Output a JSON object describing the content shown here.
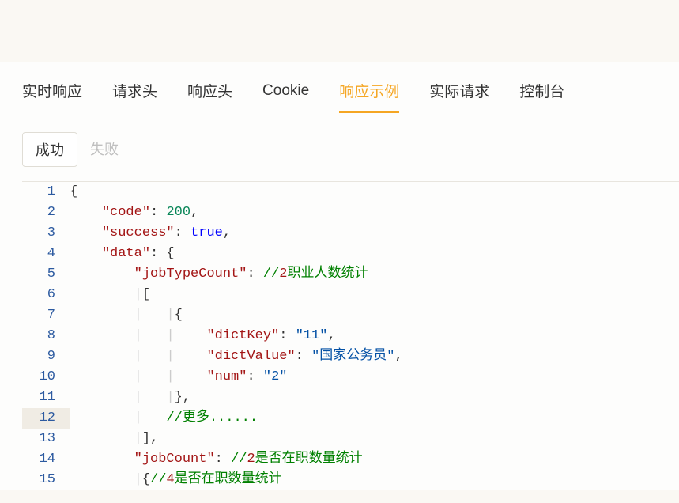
{
  "tabs": {
    "items": [
      {
        "label": "实时响应",
        "active": false
      },
      {
        "label": "请求头",
        "active": false
      },
      {
        "label": "响应头",
        "active": false
      },
      {
        "label": "Cookie",
        "active": false
      },
      {
        "label": "响应示例",
        "active": true
      },
      {
        "label": "实际请求",
        "active": false
      },
      {
        "label": "控制台",
        "active": false
      }
    ]
  },
  "subTabs": {
    "items": [
      {
        "label": "成功",
        "active": true
      },
      {
        "label": "失败",
        "active": false
      }
    ]
  },
  "code": {
    "lines": [
      {
        "n": "1",
        "tokens": [
          {
            "t": "punct",
            "v": "{"
          }
        ]
      },
      {
        "n": "2",
        "tokens": [
          {
            "t": "plain",
            "v": "    "
          },
          {
            "t": "key",
            "v": "\"code\""
          },
          {
            "t": "punct",
            "v": ": "
          },
          {
            "t": "num",
            "v": "200"
          },
          {
            "t": "punct",
            "v": ","
          }
        ]
      },
      {
        "n": "3",
        "tokens": [
          {
            "t": "plain",
            "v": "    "
          },
          {
            "t": "key",
            "v": "\"success\""
          },
          {
            "t": "punct",
            "v": ": "
          },
          {
            "t": "bool",
            "v": "true"
          },
          {
            "t": "punct",
            "v": ","
          }
        ]
      },
      {
        "n": "4",
        "tokens": [
          {
            "t": "plain",
            "v": "    "
          },
          {
            "t": "key",
            "v": "\"data\""
          },
          {
            "t": "punct",
            "v": ": {"
          }
        ]
      },
      {
        "n": "5",
        "tokens": [
          {
            "t": "plain",
            "v": "        "
          },
          {
            "t": "key",
            "v": "\"jobTypeCount\""
          },
          {
            "t": "punct",
            "v": ": "
          },
          {
            "t": "comment",
            "v": "//"
          },
          {
            "t": "commenthl",
            "v": "2"
          },
          {
            "t": "comment",
            "v": "职业人数统计"
          }
        ]
      },
      {
        "n": "6",
        "tokens": [
          {
            "t": "plain",
            "v": "        "
          },
          {
            "t": "guide",
            "v": "|"
          },
          {
            "t": "punct",
            "v": "["
          }
        ]
      },
      {
        "n": "7",
        "tokens": [
          {
            "t": "plain",
            "v": "        "
          },
          {
            "t": "guide",
            "v": "|"
          },
          {
            "t": "plain",
            "v": "   "
          },
          {
            "t": "guide",
            "v": "|"
          },
          {
            "t": "punct",
            "v": "{"
          }
        ]
      },
      {
        "n": "8",
        "tokens": [
          {
            "t": "plain",
            "v": "        "
          },
          {
            "t": "guide",
            "v": "|"
          },
          {
            "t": "plain",
            "v": "   "
          },
          {
            "t": "guide",
            "v": "|"
          },
          {
            "t": "plain",
            "v": "    "
          },
          {
            "t": "key",
            "v": "\"dictKey\""
          },
          {
            "t": "punct",
            "v": ": "
          },
          {
            "t": "str",
            "v": "\"11\""
          },
          {
            "t": "punct",
            "v": ","
          }
        ]
      },
      {
        "n": "9",
        "tokens": [
          {
            "t": "plain",
            "v": "        "
          },
          {
            "t": "guide",
            "v": "|"
          },
          {
            "t": "plain",
            "v": "   "
          },
          {
            "t": "guide",
            "v": "|"
          },
          {
            "t": "plain",
            "v": "    "
          },
          {
            "t": "key",
            "v": "\"dictValue\""
          },
          {
            "t": "punct",
            "v": ": "
          },
          {
            "t": "str",
            "v": "\"国家公务员\""
          },
          {
            "t": "punct",
            "v": ","
          }
        ]
      },
      {
        "n": "10",
        "tokens": [
          {
            "t": "plain",
            "v": "        "
          },
          {
            "t": "guide",
            "v": "|"
          },
          {
            "t": "plain",
            "v": "   "
          },
          {
            "t": "guide",
            "v": "|"
          },
          {
            "t": "plain",
            "v": "    "
          },
          {
            "t": "key",
            "v": "\"num\""
          },
          {
            "t": "punct",
            "v": ": "
          },
          {
            "t": "str",
            "v": "\"2\""
          }
        ]
      },
      {
        "n": "11",
        "tokens": [
          {
            "t": "plain",
            "v": "        "
          },
          {
            "t": "guide",
            "v": "|"
          },
          {
            "t": "plain",
            "v": "   "
          },
          {
            "t": "guide",
            "v": "|"
          },
          {
            "t": "punct",
            "v": "},"
          }
        ]
      },
      {
        "n": "12",
        "hl": true,
        "tokens": [
          {
            "t": "plain",
            "v": "        "
          },
          {
            "t": "guide",
            "v": "|"
          },
          {
            "t": "plain",
            "v": "   "
          },
          {
            "t": "comment",
            "v": "//更多......"
          }
        ]
      },
      {
        "n": "13",
        "tokens": [
          {
            "t": "plain",
            "v": "        "
          },
          {
            "t": "guide",
            "v": "|"
          },
          {
            "t": "punct",
            "v": "],"
          }
        ]
      },
      {
        "n": "14",
        "tokens": [
          {
            "t": "plain",
            "v": "        "
          },
          {
            "t": "key",
            "v": "\"jobCount\""
          },
          {
            "t": "punct",
            "v": ": "
          },
          {
            "t": "comment",
            "v": "//"
          },
          {
            "t": "commenthl",
            "v": "2"
          },
          {
            "t": "comment",
            "v": "是否在职数量统计"
          }
        ]
      },
      {
        "n": "15",
        "tokens": [
          {
            "t": "plain",
            "v": "        "
          },
          {
            "t": "guide",
            "v": "|"
          },
          {
            "t": "punct",
            "v": "{"
          },
          {
            "t": "comment",
            "v": "//"
          },
          {
            "t": "commenthl",
            "v": "4"
          },
          {
            "t": "comment",
            "v": "是否在职数量统计"
          }
        ]
      }
    ]
  }
}
